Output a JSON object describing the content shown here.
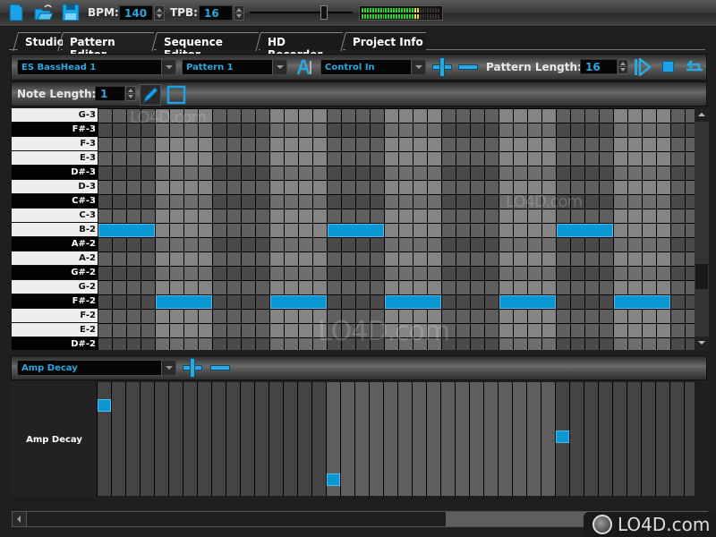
{
  "toolbar": {
    "icons": [
      "new-file-icon",
      "open-folder-icon",
      "save-icon"
    ],
    "bpm_label": "BPM:",
    "bpm_value": "140",
    "tpb_label": "TPB:",
    "tpb_value": "16",
    "volume_level": 0.7,
    "vu_meter_level": 0.72
  },
  "tabs": [
    {
      "label": "Studio",
      "active": false
    },
    {
      "label": "Pattern Editor",
      "active": true
    },
    {
      "label": "Sequence Editor",
      "active": false
    },
    {
      "label": "HD Recorder",
      "active": false
    },
    {
      "label": "Project Info",
      "active": false
    }
  ],
  "pattern_toolbar": {
    "instrument": "ES BassHead 1",
    "pattern": "Pattern 1",
    "control": "Control In",
    "pattern_length_label": "Pattern Length:",
    "pattern_length": "16",
    "note_length_label": "Note Length:",
    "note_length": "1"
  },
  "piano_keys": [
    {
      "name": "G-3",
      "black": false
    },
    {
      "name": "F#-3",
      "black": true
    },
    {
      "name": "F-3",
      "black": false
    },
    {
      "name": "E-3",
      "black": false
    },
    {
      "name": "D#-3",
      "black": true
    },
    {
      "name": "D-3",
      "black": false
    },
    {
      "name": "C#-3",
      "black": true
    },
    {
      "name": "C-3",
      "black": false
    },
    {
      "name": "B-2",
      "black": false
    },
    {
      "name": "A#-2",
      "black": true
    },
    {
      "name": "A-2",
      "black": false
    },
    {
      "name": "G#-2",
      "black": true
    },
    {
      "name": "G-2",
      "black": false
    },
    {
      "name": "F#-2",
      "black": true
    },
    {
      "name": "F-2",
      "black": false
    },
    {
      "name": "E-2",
      "black": false
    },
    {
      "name": "D#-2",
      "black": true
    }
  ],
  "notes": [
    {
      "key": "B-2",
      "start_step": 0,
      "length_steps": 4
    },
    {
      "key": "F#-2",
      "start_step": 4,
      "length_steps": 4
    },
    {
      "key": "F#-2",
      "start_step": 12,
      "length_steps": 4
    },
    {
      "key": "B-2",
      "start_step": 16,
      "length_steps": 4
    },
    {
      "key": "F#-2",
      "start_step": 20,
      "length_steps": 4
    },
    {
      "key": "F#-2",
      "start_step": 28,
      "length_steps": 4
    },
    {
      "key": "B-2",
      "start_step": 32,
      "length_steps": 4
    },
    {
      "key": "F#-2",
      "start_step": 36,
      "length_steps": 4
    }
  ],
  "automation": {
    "parameter": "Amp Decay",
    "lane_label": "Amp Decay",
    "points": [
      {
        "step": 0,
        "value": 0.83
      },
      {
        "step": 16,
        "value": 0.1
      },
      {
        "step": 32,
        "value": 0.52
      }
    ]
  },
  "watermark": "LO4D.com"
}
